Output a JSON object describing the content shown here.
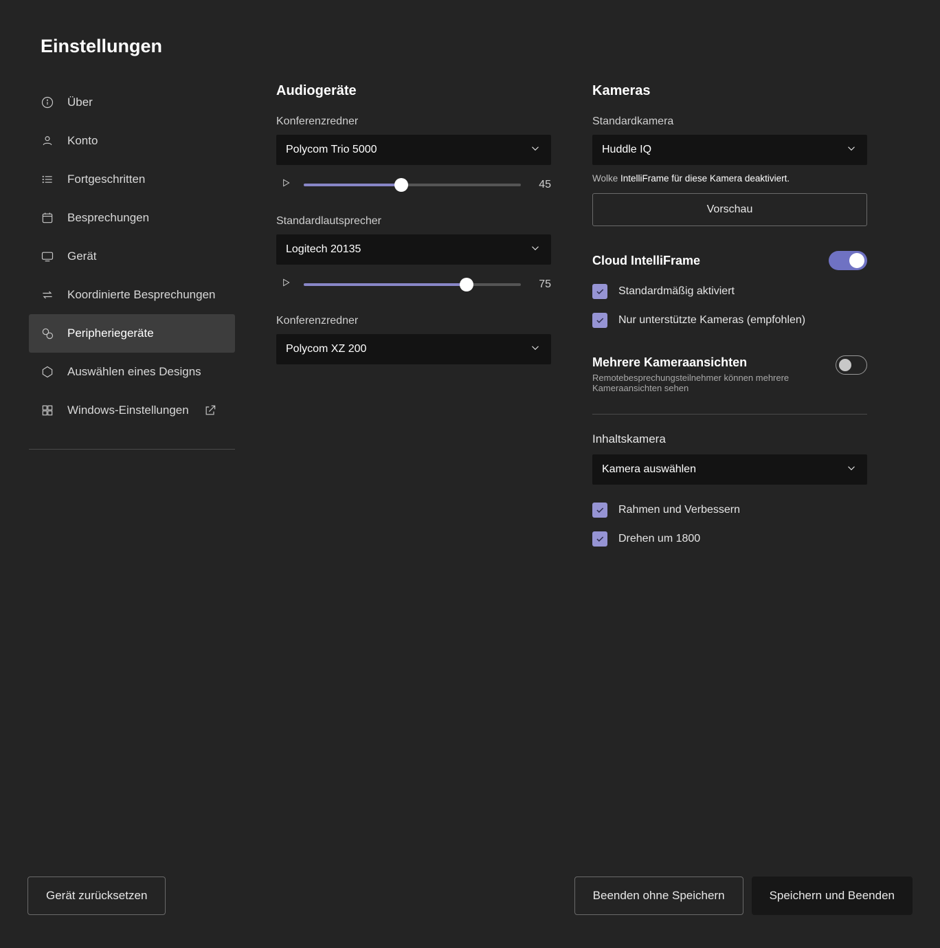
{
  "page_title": "Einstellungen",
  "sidebar": {
    "items": [
      {
        "label": "Über"
      },
      {
        "label": "Konto"
      },
      {
        "label": "Fortgeschritten"
      },
      {
        "label": "Besprechungen"
      },
      {
        "label": "Gerät"
      },
      {
        "label": "Koordinierte Besprechungen"
      },
      {
        "label": "Peripheriegeräte"
      },
      {
        "label": "Auswählen eines Designs"
      },
      {
        "label": "Windows-Einstellungen"
      }
    ],
    "active_index": 6
  },
  "audio": {
    "section_title": "Audiogeräte",
    "conf_speaker": {
      "label": "Konferenzredner",
      "value": "Polycom Trio 5000",
      "volume": 45
    },
    "default_speaker": {
      "label": "Standardlautsprecher",
      "value": "Logitech 20135",
      "volume": 75
    },
    "conf_speaker2": {
      "label": "Konferenzredner",
      "value": "Polycom XZ 200"
    }
  },
  "cameras": {
    "section_title": "Kameras",
    "default_camera": {
      "label": "Standardkamera",
      "value": "Huddle IQ"
    },
    "note_prefix": "Wolke",
    "note_rest": "IntelliFrame für diese Kamera deaktiviert.",
    "preview_button": "Vorschau",
    "cloud_intelliframe": {
      "label": "Cloud IntelliFrame",
      "enabled": true,
      "default_on": {
        "label": "Standardmäßig aktiviert",
        "checked": true
      },
      "supported_only": {
        "label": "Nur unterstützte Kameras (empfohlen)",
        "checked": true
      }
    },
    "multi_view": {
      "label": "Mehrere Kameraansichten",
      "sub": "Remotebesprechungsteilnehmer können mehrere Kameraansichten sehen",
      "enabled": false
    },
    "content_camera": {
      "label": "Inhaltskamera",
      "value": "Kamera auswählen",
      "frame_enhance": {
        "label": "Rahmen und Verbessern",
        "checked": true
      },
      "rotate_180": {
        "label": "Drehen um 1800",
        "checked": true
      }
    }
  },
  "footer": {
    "reset": "Gerät zurücksetzen",
    "exit_no_save": "Beenden ohne Speichern",
    "save_exit": "Speichern und Beenden"
  }
}
